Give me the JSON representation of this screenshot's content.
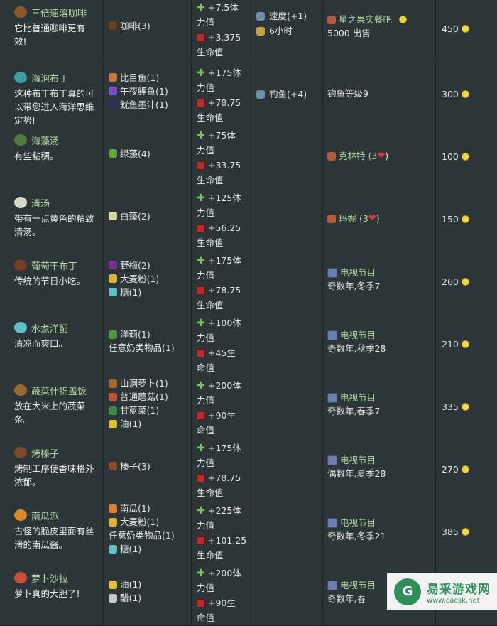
{
  "colors": {
    "bg": "#2c3538",
    "name": "#b8d7a2",
    "coin": "#f2d64b",
    "energy": "#7cc35a",
    "health": "#b82c2c"
  },
  "rows": [
    {
      "icon": "coffee-icon",
      "icon_color": "#8a5a2b",
      "name": "三倍速溶咖啡",
      "desc": "它比普通咖啡更有\n效!",
      "ingredients": [
        {
          "icon": "coffee-bean-icon",
          "color": "#6b3f1f",
          "text": "咖啡(3)"
        }
      ],
      "energy": "+7.5体",
      "energy2": "力值",
      "health": "+3.375",
      "health2": "生命值",
      "buffs": [
        {
          "icon": "speed-icon",
          "text": "速度(+1)"
        },
        {
          "icon": "clock-icon",
          "text": "6小时"
        }
      ],
      "source": {
        "icon": "merchant-icon",
        "name": "星之果实餐吧",
        "extra": "5000 出售",
        "coin": true
      },
      "price": "450"
    },
    {
      "icon": "pudding-icon",
      "icon_color": "#3a9fa8",
      "name": "海泡布丁",
      "desc": "这种布丁布丁真的可\n以带您进入海洋思维\n定势!",
      "ingredients": [
        {
          "icon": "flounder-icon",
          "color": "#c9773a",
          "text": "比目鱼(1)"
        },
        {
          "icon": "midnight-carp-icon",
          "color": "#7b4fc7",
          "text": "午夜鲤鱼(1)"
        },
        {
          "icon": "squid-ink-icon",
          "color": "#2a2f5a",
          "text": "鱿鱼墨汁(1)"
        }
      ],
      "energy": "+175体",
      "energy2": "力值",
      "health": "+78.75",
      "health2": "生命值",
      "buffs": [
        {
          "icon": "fishing-icon",
          "text": "钓鱼(+4)"
        }
      ],
      "source": {
        "icon": "",
        "name": "",
        "extra": "钓鱼等级9",
        "coin": false
      },
      "price": "300"
    },
    {
      "icon": "seaweed-soup-icon",
      "icon_color": "#4f7a3a",
      "name": "海藻汤",
      "desc": "有些粘稠。",
      "ingredients": [
        {
          "icon": "green-algae-icon",
          "color": "#5caa3d",
          "text": "绿藻(4)"
        }
      ],
      "energy": "+75体",
      "energy2": "力值",
      "health": "+33.75",
      "health2": "生命值",
      "buffs": [],
      "source": {
        "icon": "clint-icon",
        "name": "克林特 (3",
        "heart": true,
        "extra": "",
        "coin": false
      },
      "price": "100"
    },
    {
      "icon": "pale-broth-icon",
      "icon_color": "#d8d8c8",
      "name": "清汤",
      "desc": "带有一点黄色的精致\n清汤。",
      "ingredients": [
        {
          "icon": "white-algae-icon",
          "color": "#d8d8a0",
          "text": "白藻(2)"
        }
      ],
      "energy": "+125体",
      "energy2": "力值",
      "health": "+56.25",
      "health2": "生命值",
      "buffs": [],
      "source": {
        "icon": "marnie-icon",
        "name": "玛妮 (3",
        "heart": true,
        "extra": "",
        "coin": false
      },
      "price": "150"
    },
    {
      "icon": "plum-pudding-icon",
      "icon_color": "#7a3a2a",
      "name": "葡萄干布丁",
      "desc": "传统的节日小吃。",
      "ingredients": [
        {
          "icon": "wild-plum-icon",
          "color": "#7b2f8f",
          "text": "野梅(2)"
        },
        {
          "icon": "wheat-flour-icon",
          "color": "#e0b23a",
          "text": "大麦粉(1)"
        },
        {
          "icon": "sugar-icon",
          "color": "#5fc0c8",
          "text": "糖(1)"
        }
      ],
      "energy": "+175体",
      "energy2": "力值",
      "health": "+78.75",
      "health2": "生命值",
      "buffs": [],
      "source": {
        "icon": "tv-icon",
        "name": "电视节目",
        "extra": "奇数年,冬季7",
        "coin": false
      },
      "price": "260"
    },
    {
      "icon": "radish-salad-icon",
      "icon_color": "#5fc0c8",
      "name": "水煮洋蓟",
      "desc": "清凉而爽口。",
      "ingredients": [
        {
          "icon": "artichoke-icon",
          "color": "#4f9a3a",
          "text": "洋蓟(1)"
        },
        {
          "icon": "",
          "color": "",
          "text": "任意奶类物品(1)"
        }
      ],
      "energy": "+100体",
      "energy2": "力值",
      "health": "+45生",
      "health2": "命值",
      "buffs": [],
      "source": {
        "icon": "tv-icon",
        "name": "电视节目",
        "extra": "奇数年,秋季28",
        "coin": false
      },
      "price": "210"
    },
    {
      "icon": "vegetable-medley-icon",
      "icon_color": "#9a6a2a",
      "name": "蔬菜什锦盖饭",
      "desc": "放在大米上的蔬菜\n条。",
      "ingredients": [
        {
          "icon": "yam-icon",
          "color": "#a86a2a",
          "text": "山洞萝卜(1)"
        },
        {
          "icon": "mushroom-icon",
          "color": "#c94f3a",
          "text": "普通蘑菇(1)"
        },
        {
          "icon": "kale-icon",
          "color": "#3a8a4a",
          "text": "甘蓝菜(1)"
        },
        {
          "icon": "oil-icon",
          "color": "#e0c23a",
          "text": "油(1)"
        }
      ],
      "energy": "+200体",
      "energy2": "力值",
      "health": "+90生",
      "health2": "命值",
      "buffs": [],
      "source": {
        "icon": "tv-icon",
        "name": "电视节目",
        "extra": "奇数年,春季7",
        "coin": false
      },
      "price": "335"
    },
    {
      "icon": "roasted-hazelnut-icon",
      "icon_color": "#7a4a2a",
      "name": "烤榛子",
      "desc": "烤制工序使香味格外\n浓郁。",
      "ingredients": [
        {
          "icon": "hazelnut-icon",
          "color": "#8a4a2a",
          "text": "榛子(3)"
        }
      ],
      "energy": "+175体",
      "energy2": "力值",
      "health": "+78.75",
      "health2": "生命值",
      "buffs": [],
      "source": {
        "icon": "tv-icon",
        "name": "电视节目",
        "extra": "偶数年,夏季28",
        "coin": false
      },
      "price": "270"
    },
    {
      "icon": "pumpkin-pie-icon",
      "icon_color": "#d88a2a",
      "name": "南瓜派",
      "desc": "古怪的脆皮里面有丝\n滑的南瓜酱。",
      "ingredients": [
        {
          "icon": "pumpkin-icon",
          "color": "#e0802a",
          "text": "南瓜(1)"
        },
        {
          "icon": "wheat-flour-icon",
          "color": "#e0b23a",
          "text": "大麦粉(1)"
        },
        {
          "icon": "",
          "color": "",
          "text": "任意奶类物品(1)"
        },
        {
          "icon": "sugar-icon",
          "color": "#5fc0c8",
          "text": "糖(1)"
        }
      ],
      "energy": "+225体",
      "energy2": "力值",
      "health": "+101.25",
      "health2": "生命值",
      "buffs": [],
      "source": {
        "icon": "tv-icon",
        "name": "电视节目",
        "extra": "奇数年,冬季21",
        "coin": false
      },
      "price": "385"
    },
    {
      "icon": "radish-salad-icon2",
      "icon_color": "#c94f3a",
      "name": "萝卜沙拉",
      "desc": "萝卜真的大胆了!",
      "ingredients": [
        {
          "icon": "oil-icon",
          "color": "#e0c23a",
          "text": "油(1)"
        },
        {
          "icon": "vinegar-icon",
          "color": "#c8c8c8",
          "text": "醋(1)"
        }
      ],
      "energy": "+200体",
      "energy2": "力值",
      "health": "+90生",
      "health2": "命值",
      "buffs": [],
      "source": {
        "icon": "tv-icon",
        "name": "电视节目",
        "extra": "奇数年,春",
        "coin": false
      },
      "price": ""
    }
  ],
  "watermark": {
    "title": "易采游戏网",
    "url": "www.cacsk.net",
    "logo_char": "G"
  }
}
